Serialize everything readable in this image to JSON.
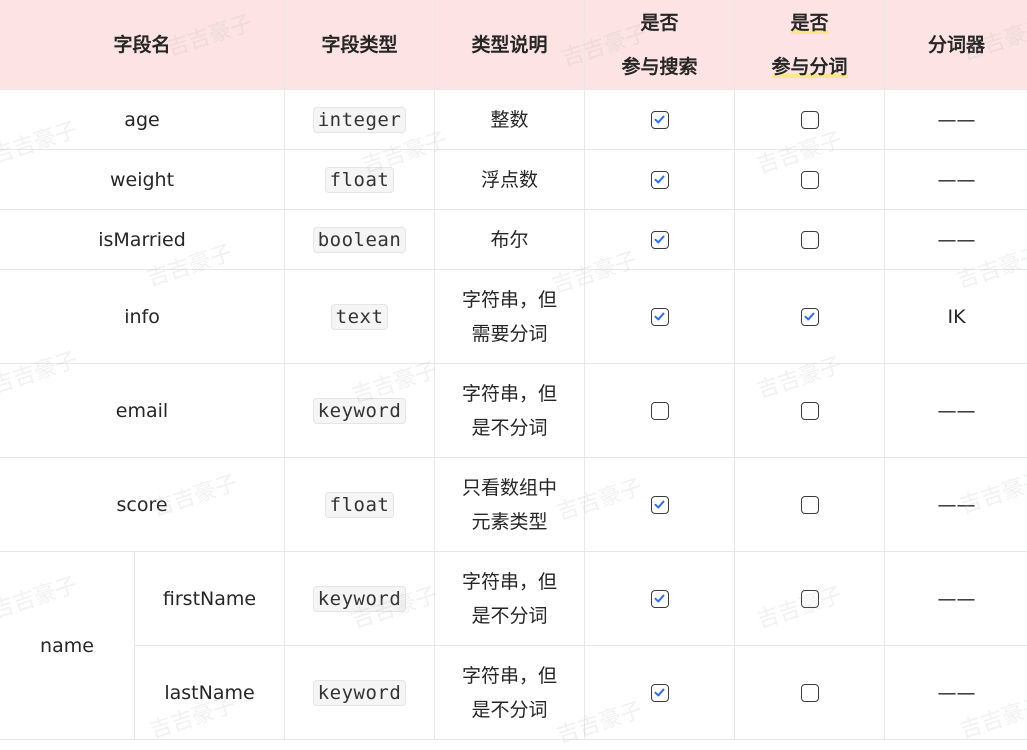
{
  "headers": {
    "field_name": "字段名",
    "field_type": "字段类型",
    "type_desc": "类型说明",
    "searchable_line1": "是否",
    "searchable_line2": "参与搜索",
    "tokenized_line1": "是否",
    "tokenized_line2": "参与分词",
    "analyzer": "分词器"
  },
  "rows": [
    {
      "name": "age",
      "type": "integer",
      "desc": "整数",
      "searchable": true,
      "tokenized": false,
      "analyzer": "——"
    },
    {
      "name": "weight",
      "type": "float",
      "desc": "浮点数",
      "searchable": true,
      "tokenized": false,
      "analyzer": "——"
    },
    {
      "name": "isMarried",
      "type": "boolean",
      "desc": "布尔",
      "searchable": true,
      "tokenized": false,
      "analyzer": "——"
    },
    {
      "name": "info",
      "type": "text",
      "desc": "字符串，但需要分词",
      "searchable": true,
      "tokenized": true,
      "analyzer": "IK"
    },
    {
      "name": "email",
      "type": "keyword",
      "desc": "字符串，但是不分词",
      "searchable": false,
      "tokenized": false,
      "analyzer": "——"
    },
    {
      "name": "score",
      "type": "float",
      "desc": "只看数组中元素类型",
      "searchable": true,
      "tokenized": false,
      "analyzer": "——"
    }
  ],
  "group": {
    "name": "name",
    "children": [
      {
        "name": "firstName",
        "type": "keyword",
        "desc": "字符串，但是不分词",
        "searchable": true,
        "tokenized": false,
        "analyzer": "——"
      },
      {
        "name": "lastName",
        "type": "keyword",
        "desc": "字符串，但是不分词",
        "searchable": true,
        "tokenized": false,
        "analyzer": "——"
      }
    ]
  },
  "watermark_text": "吉吉豪子",
  "colors": {
    "header_bg": "#fde3e3",
    "check": "#2f6fe0",
    "border": "#e8e8e8"
  }
}
